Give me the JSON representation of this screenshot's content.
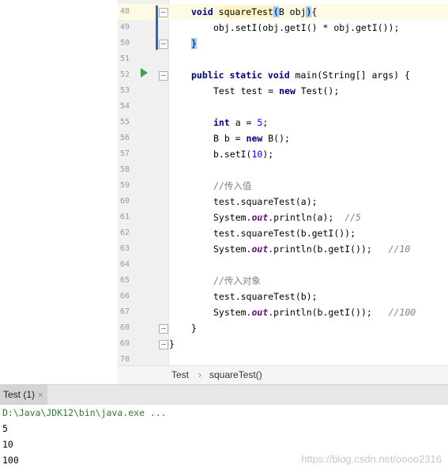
{
  "editor": {
    "line_numbers": [
      "48",
      "49",
      "50",
      "51",
      "52",
      "53",
      "54",
      "55",
      "56",
      "57",
      "58",
      "59",
      "60",
      "61",
      "62",
      "63",
      "64",
      "65",
      "66",
      "67",
      "68",
      "69",
      "70"
    ],
    "lines": {
      "l48": {
        "kw": "void",
        "method": "squareTest",
        "p1": "(",
        "args": "B obj",
        "p2": ")",
        "brace": "{"
      },
      "l49": {
        "text": "obj.setI(obj.getI() * obj.getI());"
      },
      "l50": {
        "brace": "}"
      },
      "l52": {
        "kw": "public static void",
        "rest": " main(String[] args) {"
      },
      "l53": {
        "a": "Test test = ",
        "kw": "new",
        "b": " Test();"
      },
      "l55": {
        "kw": "int",
        "a": " a = ",
        "num": "5",
        "b": ";"
      },
      "l56": {
        "a": "B b = ",
        "kw": "new",
        "b": " B();"
      },
      "l57": {
        "a": "b.setI(",
        "num": "10",
        "b": ");"
      },
      "l59": {
        "comment": "//传入值"
      },
      "l60": {
        "text": "test.squareTest(a);"
      },
      "l61": {
        "a": "System.",
        "field": "out",
        "b": ".println(a);  ",
        "comment": "//5"
      },
      "l62": {
        "text": "test.squareTest(b.getI());"
      },
      "l63": {
        "a": "System.",
        "field": "out",
        "b": ".println(b.getI());   ",
        "comment": "//10"
      },
      "l65": {
        "comment": "//传入对象"
      },
      "l66": {
        "text": "test.squareTest(b);"
      },
      "l67": {
        "a": "System.",
        "field": "out",
        "b": ".println(b.getI());   ",
        "comment": "//100"
      },
      "l68": {
        "text": "}"
      },
      "l69": {
        "text": "}"
      }
    }
  },
  "breadcrumb": {
    "class": "Test",
    "separator": "›",
    "method": "squareTest()"
  },
  "run_tab": {
    "label": "Test (1)",
    "close": "×"
  },
  "console": {
    "command": "D:\\Java\\JDK12\\bin\\java.exe ...",
    "output": [
      "5",
      "10",
      "100"
    ]
  },
  "watermark": "https://blog.csdn.net/oooo2316",
  "colors": {
    "keyword": "#000080",
    "number": "#0000ff",
    "comment": "#808080",
    "field": "#660e7a",
    "run_icon": "#499c54",
    "command": "#2e7d32"
  }
}
